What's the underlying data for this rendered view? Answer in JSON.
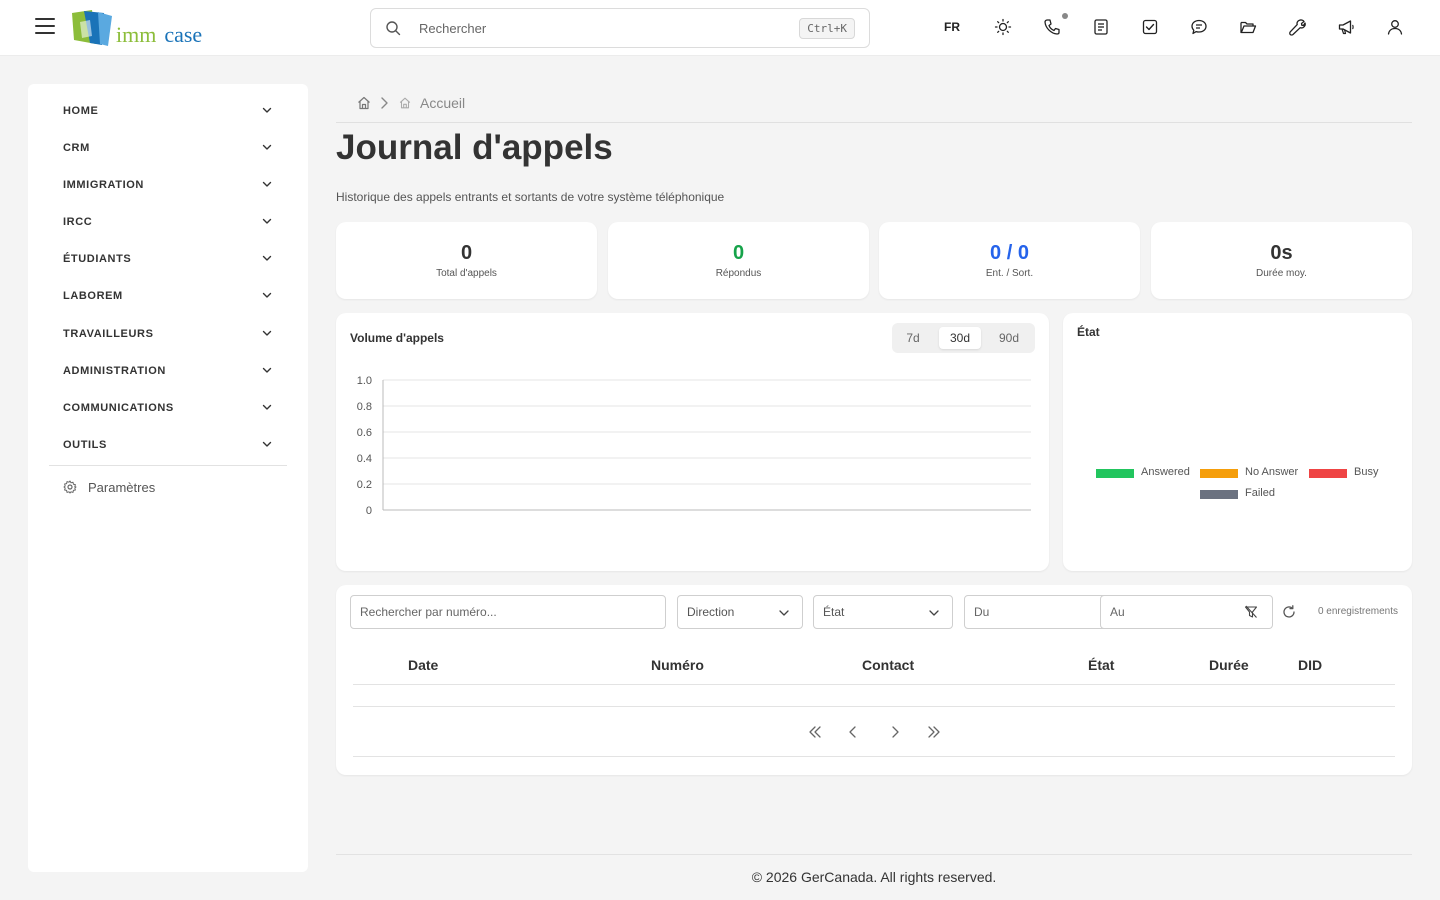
{
  "header": {
    "logo": {
      "text_imm": "imm",
      "text_case": "case"
    },
    "search": {
      "placeholder": "Rechercher",
      "shortcut": "Ctrl+K"
    },
    "language": "FR",
    "icons": [
      "theme-toggle-icon",
      "phone-icon",
      "notes-icon",
      "tasks-icon",
      "chat-icon",
      "folder-icon",
      "tools-icon",
      "announcement-icon",
      "user-icon"
    ]
  },
  "sidebar": {
    "items": [
      {
        "label": "HOME"
      },
      {
        "label": "CRM"
      },
      {
        "label": "IMMIGRATION"
      },
      {
        "label": "IRCC"
      },
      {
        "label": "ÉTUDIANTS"
      },
      {
        "label": "LABOREM"
      },
      {
        "label": "TRAVAILLEURS"
      },
      {
        "label": "ADMINISTRATION"
      },
      {
        "label": "COMMUNICATIONS"
      },
      {
        "label": "OUTILS"
      }
    ],
    "settings_label": "Paramètres"
  },
  "breadcrumb": {
    "current": "Accueil"
  },
  "page": {
    "title": "Journal d'appels",
    "subtitle": "Historique des appels entrants et sortants de votre système téléphonique"
  },
  "stats": [
    {
      "value": "0",
      "label": "Total d'appels",
      "color": "#333333"
    },
    {
      "value": "0",
      "label": "Répondus",
      "color": "#16a34a"
    },
    {
      "value": "0 / 0",
      "label": "Ent. / Sort.",
      "color": "#2563eb"
    },
    {
      "value": "0s",
      "label": "Durée moy.",
      "color": "#333333"
    }
  ],
  "volume_panel": {
    "title": "Volume d'appels",
    "ranges": [
      "7d",
      "30d",
      "90d"
    ],
    "active_range": "30d"
  },
  "status_panel": {
    "title": "État",
    "legend": [
      {
        "label": "Answered",
        "color": "#22c55e"
      },
      {
        "label": "No Answer",
        "color": "#f59e0b"
      },
      {
        "label": "Busy",
        "color": "#ef4444"
      },
      {
        "label": "Failed",
        "color": "#6b7280"
      }
    ]
  },
  "chart_data": {
    "type": "line",
    "title": "Volume d'appels",
    "x": [],
    "series": [],
    "ylim": [
      0,
      1.0
    ],
    "y_ticks": [
      "1.0",
      "0.8",
      "0.6",
      "0.4",
      "0.2",
      "0"
    ],
    "grid": true
  },
  "filters": {
    "number_placeholder": "Rechercher par numéro...",
    "direction_label": "Direction",
    "status_label": "État",
    "from_placeholder": "Du",
    "to_placeholder": "Au",
    "record_count": "0 enregistrements"
  },
  "table": {
    "columns": [
      "Date",
      "Numéro",
      "Contact",
      "État",
      "Durée",
      "DID"
    ],
    "rows": []
  },
  "footer": {
    "text": "© 2026 GerCanada. All rights reserved."
  }
}
